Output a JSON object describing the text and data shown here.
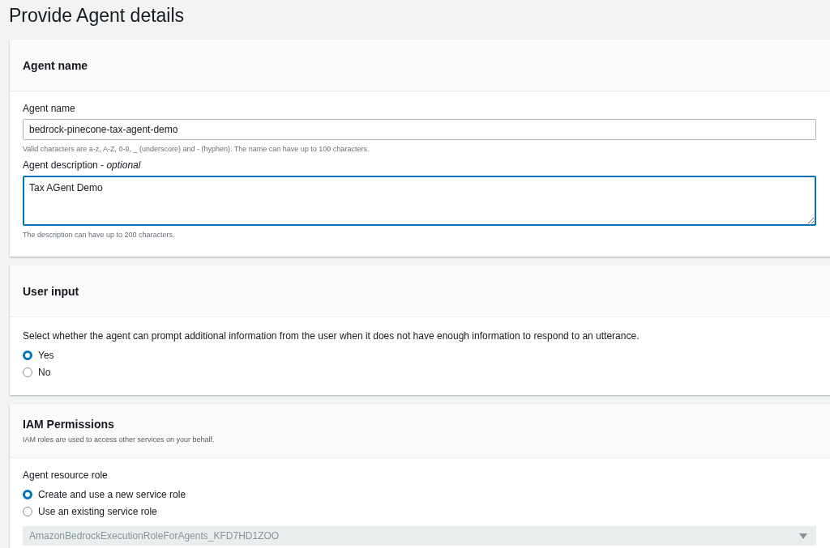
{
  "page_title": "Provide Agent details",
  "sections": [
    {
      "title": "Agent name",
      "items": [
        {
          "kind": "input",
          "label": "Agent name",
          "value": "bedrock-pinecone-tax-agent-demo",
          "hint": "Valid characters are a-z, A-Z, 0-9, _ (underscore) and - (hyphen). The name can have up to 100 characters."
        },
        {
          "kind": "textarea",
          "label": "Agent description - *optional*",
          "value": "Tax AGent Demo",
          "focused": true,
          "hint": "The description can have up to 200 characters."
        }
      ]
    },
    {
      "title": "User input",
      "items": [
        {
          "kind": "radio",
          "text": "Select whether the agent can prompt additional information from the user when it does not have enough information to respond to an utterance.",
          "options": [
            {
              "label": "Yes",
              "selected": true
            },
            {
              "label": "No",
              "selected": false
            }
          ]
        }
      ]
    },
    {
      "title": "IAM Permissions",
      "subtitle": "IAM roles are used to access other services on your behalf.",
      "items": [
        {
          "kind": "radio",
          "label": "Agent resource role",
          "options": [
            {
              "label": "Create and use a new service role",
              "selected": true
            },
            {
              "label": "Use an existing service role",
              "selected": false
            }
          ]
        },
        {
          "kind": "select",
          "value": "AmazonBedrockExecutionRoleForAgents_KFD7HD1ZOO",
          "disabled": true
        }
      ]
    }
  ]
}
